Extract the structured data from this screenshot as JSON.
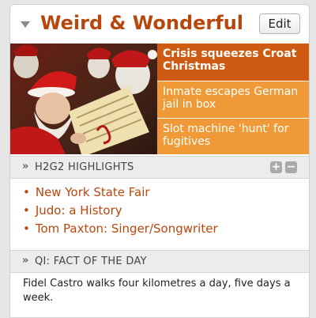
{
  "widget": {
    "title": "Weird & Wonderful",
    "edit_label": "Edit"
  },
  "feature": {
    "image_description_icon": "santa-photo",
    "stories": [
      {
        "title": "Crisis squeezes Croat Christmas"
      },
      {
        "title": "Inmate escapes German jail in box"
      },
      {
        "title": "Slot machine 'hunt' for fugitives"
      }
    ]
  },
  "highlights": {
    "heading": "H2G2 HIGHLIGHTS",
    "items": [
      {
        "label": "New York State Fair"
      },
      {
        "label": "Judo: a History"
      },
      {
        "label": "Tom Paxton: Singer/Songwriter"
      }
    ]
  },
  "qi": {
    "heading": "QI: FACT OF THE DAY",
    "fact": "Fidel Castro walks four kilometres a day, five days a week."
  },
  "colors": {
    "accent": "#b8470d",
    "story_primary": "#cf5b12",
    "story_secondary": "#ef9a36"
  }
}
